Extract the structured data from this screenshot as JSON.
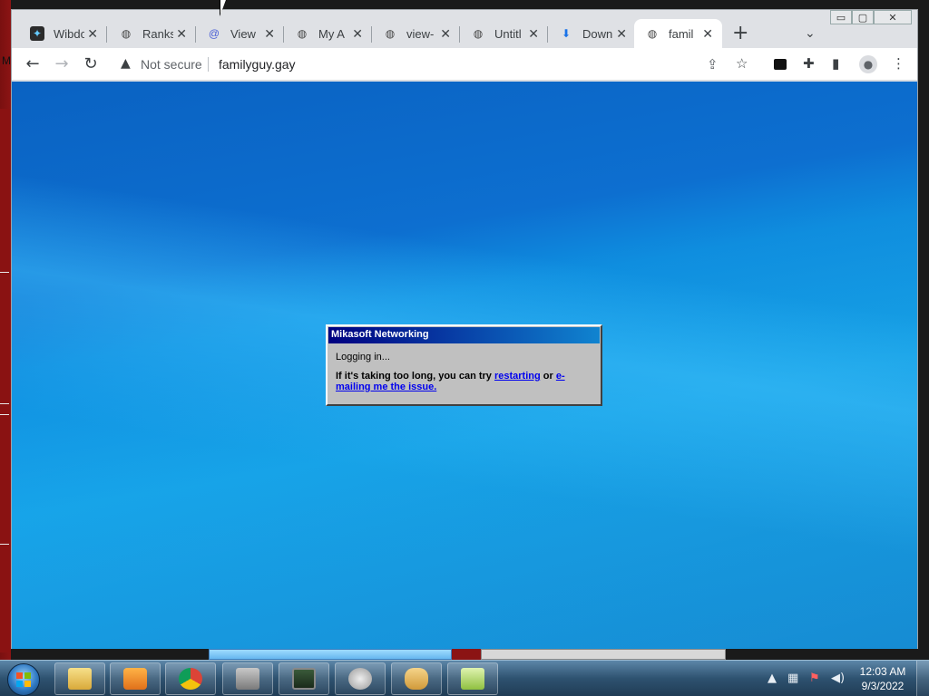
{
  "desktop": {
    "edge_letter": "M"
  },
  "window": {
    "controls": {
      "minimize": "▭",
      "restore": "▢",
      "close": "✕"
    }
  },
  "tabs": [
    {
      "title": "Wibdo",
      "icon": "stamp-icon",
      "active": false
    },
    {
      "title": "Ranks",
      "icon": "globe-icon",
      "active": false
    },
    {
      "title": "View",
      "icon": "at-icon",
      "active": false
    },
    {
      "title": "My A",
      "icon": "globe-icon",
      "active": false
    },
    {
      "title": "view-",
      "icon": "globe-icon",
      "active": false
    },
    {
      "title": "Untitl",
      "icon": "globe-icon",
      "active": false
    },
    {
      "title": "Down",
      "icon": "download-icon",
      "active": false
    },
    {
      "title": "famil",
      "icon": "globe-icon",
      "active": true
    }
  ],
  "toolbar": {
    "security_label": "Not secure",
    "url": "familyguy.gay"
  },
  "dialog": {
    "title": "Mikasoft Networking",
    "status": "Logging in...",
    "message_prefix": "If it's taking too long, you can try",
    "link_restart": "restarting",
    "message_middle": "or",
    "link_email": "e-mailing me the issue."
  },
  "taskbar": {
    "items": [
      "file-explorer",
      "media-player",
      "chrome",
      "security-tool",
      "task-manager",
      "speaker",
      "handshake",
      "paint-tool"
    ],
    "clock_time": "12:03 AM",
    "clock_date": "9/3/2022"
  },
  "colors": {
    "accent_blue": "#0e7ad6",
    "dialog_title_start": "#000080",
    "dialog_title_end": "#1084d0",
    "taskbar": "#2e5270"
  }
}
